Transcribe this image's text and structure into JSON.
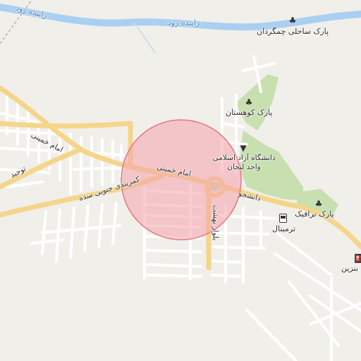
{
  "map": {
    "colors": {
      "background": "#f1efea",
      "river": "#a9d0f2",
      "park": "#c8e0b0",
      "main_road": "#f5d58a",
      "street": "#ffffff",
      "highlight_fill": "#f4a3ab",
      "highlight_stroke": "#e07a86"
    },
    "labels": {
      "river_left": "زاینده رود",
      "river_mid": "زاینده رود",
      "park_chamgerdan": "پارک ساحلی چمگردان",
      "park_kouhestan": "پارک کوهستان",
      "university": "دانشگاه آزاد اسلامی واحد لنجان",
      "park_traffic": "پارک ترافیک",
      "terminal": "ترمینال",
      "fuel": "بنزین",
      "road_imam_khomeini_west": "امام خمینی",
      "road_imam_khomeini_center": "امام خمینی",
      "road_kamarbandi": "کمربندی جنوبی سده",
      "road_towhid": "توحید",
      "road_daneshjoo": "دانشجو",
      "road_behesht": "بلوار بهشت"
    },
    "icons": {
      "park": "tree-icon",
      "university": "graduation-cap-icon",
      "terminal": "bus-icon",
      "fuel": "fuel-pump-icon"
    }
  }
}
